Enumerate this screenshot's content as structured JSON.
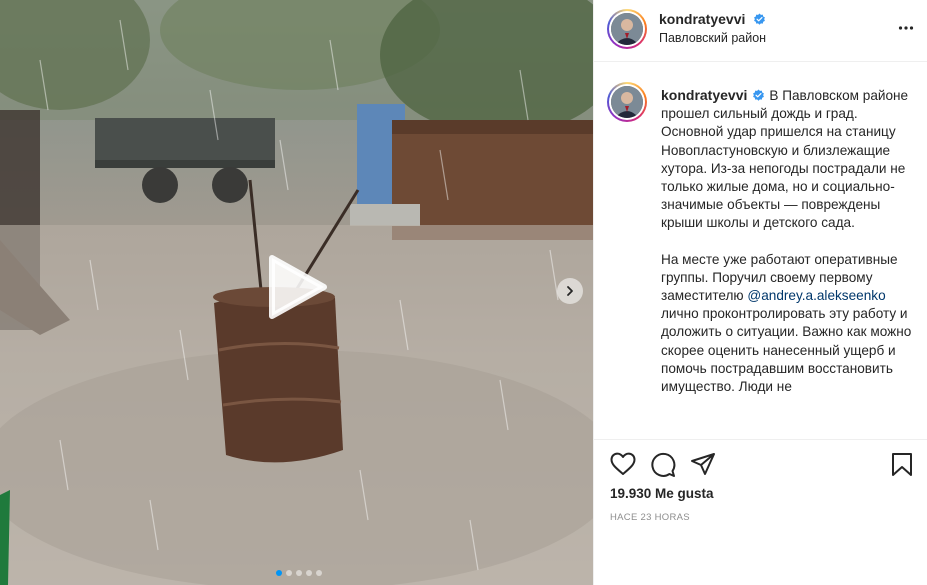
{
  "post": {
    "author": "kondratyevvi",
    "location": "Павловский район",
    "verified": true
  },
  "caption": {
    "author": "kondratyevvi",
    "paragraph1": "В Павловском районе прошел сильный дождь и град. Основной удар пришелся на станицу Новопластуновскую и близлежащие хутора. Из-за непогоды пострадали не только жилые дома, но и социально-значимые объекты — повреждены крыши школы и детского сада.",
    "paragraph2_before": "На месте уже работают оперативные группы. Поручил своему первому заместителю ",
    "mention": "@andrey.a.alekseenko",
    "paragraph2_after": " лично проконтролировать эту работу и доложить о ситуации. Важно как можно скорее оценить нанесенный ущерб и помочь пострадавшим восстановить имущество. Люди не"
  },
  "stats": {
    "likes": "19.930 Me gusta",
    "time": "HACE 23 HORAS"
  },
  "media": {
    "carousel_total": 5,
    "carousel_active": 1
  },
  "icons": {
    "like": "heart-icon",
    "comment": "comment-icon",
    "share": "paper-plane-icon",
    "save": "bookmark-icon",
    "more": "more-horizontal-icon",
    "play": "play-icon",
    "next": "chevron-right-icon",
    "verified": "verified-badge-icon"
  },
  "colors": {
    "verified": "#3897f0",
    "mention": "#00376b",
    "text": "#262626",
    "muted": "#8e8e8e",
    "active_dot": "#0095f6"
  }
}
